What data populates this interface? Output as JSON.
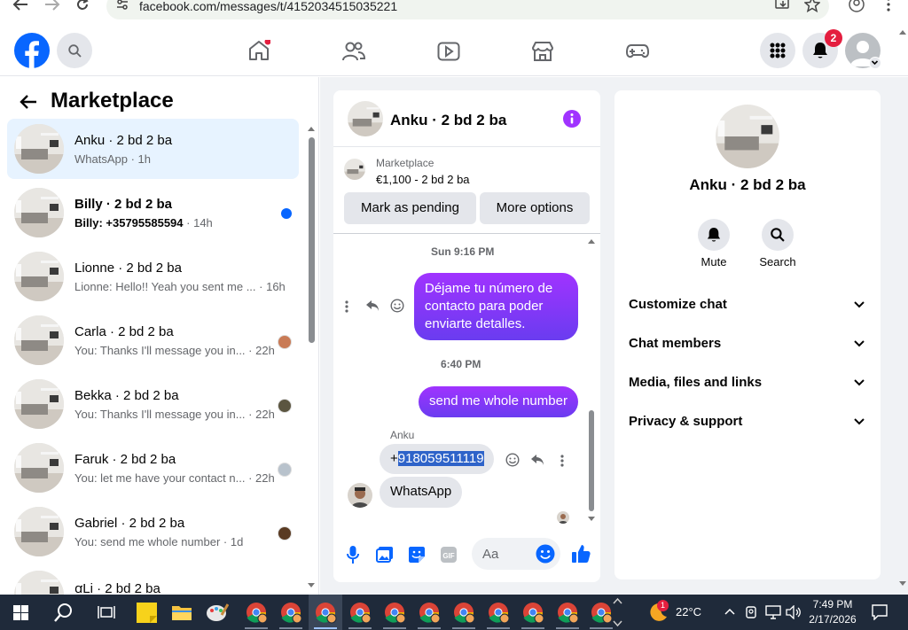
{
  "browser": {
    "url": "facebook.com/messages/t/4152034515035221"
  },
  "sidebar": {
    "title": "Marketplace",
    "items": [
      {
        "name": "Anku · 2 bd 2 ba",
        "preview": "WhatsApp",
        "sender": "",
        "time": "1h"
      },
      {
        "name": "Billy · 2 bd 2 ba",
        "preview": "",
        "sender": "Billy: +35795585594",
        "time": "14h"
      },
      {
        "name": "Lionne · 2 bd 2 ba",
        "preview": "Lionne: Hello!! Yeah you sent me ...",
        "sender": "",
        "time": "16h"
      },
      {
        "name": "Carla · 2 bd 2 ba",
        "preview": "You: Thanks I'll message you in...",
        "sender": "",
        "time": "22h"
      },
      {
        "name": "Bekka · 2 bd 2 ba",
        "preview": "You: Thanks I'll message you in...",
        "sender": "",
        "time": "22h"
      },
      {
        "name": "Faruk · 2 bd 2 ba",
        "preview": "You: let me have your contact n...",
        "sender": "",
        "time": "22h"
      },
      {
        "name": "Gabriel · 2 bd 2 ba",
        "preview": "You: send me whole number",
        "sender": "",
        "time": "1d"
      },
      {
        "name": "ꭤLi · 2 bd 2 ba",
        "preview": "",
        "sender": "",
        "time": ""
      }
    ]
  },
  "header": {
    "notification_count": "2"
  },
  "chat": {
    "title": "Anku · 2 bd 2 ba",
    "listing_source": "Marketplace",
    "listing_price": "€1,100 - 2 bd 2 ba",
    "mark_pending_label": "Mark as pending",
    "more_options_label": "More options",
    "messages": {
      "stamp1": "Sun 9:16 PM",
      "out1": "Déjame tu número de contacto para poder enviarte detalles.",
      "stamp2": "6:40 PM",
      "out2": "send me whole number",
      "sender_label": "Anku",
      "in1_prefix": "+",
      "in1_selected": "918059511119",
      "in2": "WhatsApp"
    },
    "composer_placeholder": "Aa"
  },
  "info_panel": {
    "name": "Anku · 2 bd 2 ba",
    "mute_label": "Mute",
    "search_label": "Search",
    "sections": [
      "Customize chat",
      "Chat members",
      "Media, files and links",
      "Privacy & support"
    ]
  },
  "taskbar": {
    "weather": "22°C",
    "weather_badge": "1",
    "time": "7:49 PM",
    "date": "2/17/2026"
  },
  "colors": {
    "fb_blue": "#0866ff",
    "messenger_purple": "#a033ff",
    "selected_row": "#e7f3ff",
    "unread_dot": "#0866ff",
    "badge_red": "#e41e3f"
  }
}
